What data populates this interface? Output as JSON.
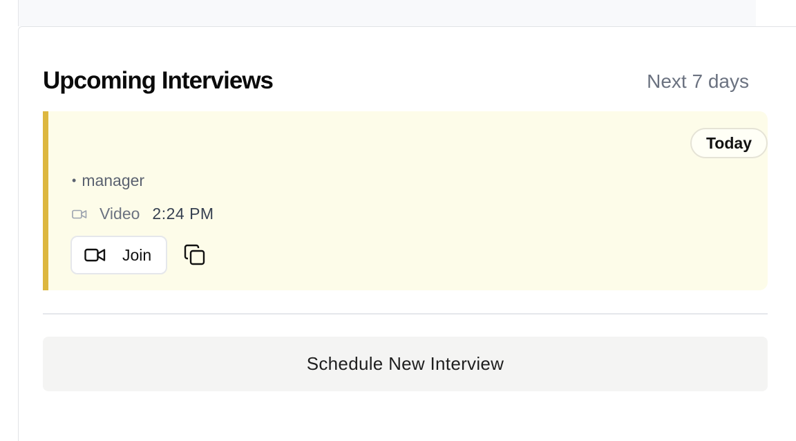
{
  "section": {
    "title": "Upcoming Interviews",
    "range_label": "Next 7 days"
  },
  "interview": {
    "badge": "Today",
    "role": "manager",
    "bullet": "•",
    "type": "Video",
    "time": "2:24 PM",
    "join_label": "Join",
    "accent_color": "#ddb73f",
    "background_color": "#fdfce9"
  },
  "actions": {
    "schedule_label": "Schedule New Interview"
  },
  "icons": {
    "meeting_type": "video-camera-icon",
    "join": "video-camera-icon",
    "copy": "copy-icon"
  }
}
